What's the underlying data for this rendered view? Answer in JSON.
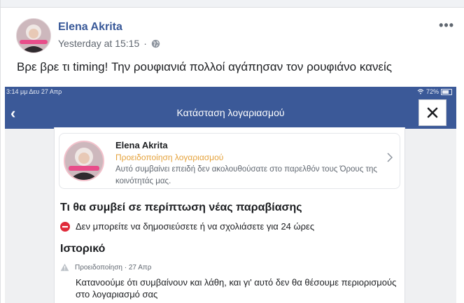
{
  "post": {
    "author": "Elena Akrita",
    "timestamp": "Yesterday at 15:15",
    "privacy_icon": "globe-icon",
    "more_icon": "more-options-icon",
    "more_label": "•••",
    "text": "Βρε βρε τι timing! Την ρουφιανιά πολλοί αγάπησαν τον ρουφιάνο κανείς"
  },
  "screenshot": {
    "status": {
      "left": "3:14 μμ   Δευ 27 Απρ",
      "battery": "72%"
    },
    "nav": {
      "back": "‹",
      "title": "Κατάσταση λογαριασμού",
      "close": "close-icon"
    },
    "warning": {
      "name": "Elena Akrita",
      "subtitle": "Προειδοποίηση λογαριασμού",
      "description": "Αυτό συμβαίνει επειδή δεν ακολουθούσατε στο παρελθόν τους Όρους της κοινότητάς μας."
    },
    "next_violation_heading": "Τι θα συμβεί σε περίπτωση νέας παραβίασης",
    "restriction_text": "Δεν μπορείτε να δημοσιεύσετε ή να σχολιάσετε για 24 ώρες",
    "history_heading": "Ιστορικό",
    "history_item": {
      "meta": "Προειδοποίηση · 27 Απρ",
      "text": "Κατανοούμε ότι συμβαίνουν και λάθη, και γι' αυτό δεν θα θέσουμε περιορισμούς στο λογαριασμό σας"
    }
  },
  "colors": {
    "facebook_blue": "#3b5998",
    "link_blue": "#385898",
    "warning_orange": "#e5a23b",
    "stop_red": "#e02a3a"
  }
}
